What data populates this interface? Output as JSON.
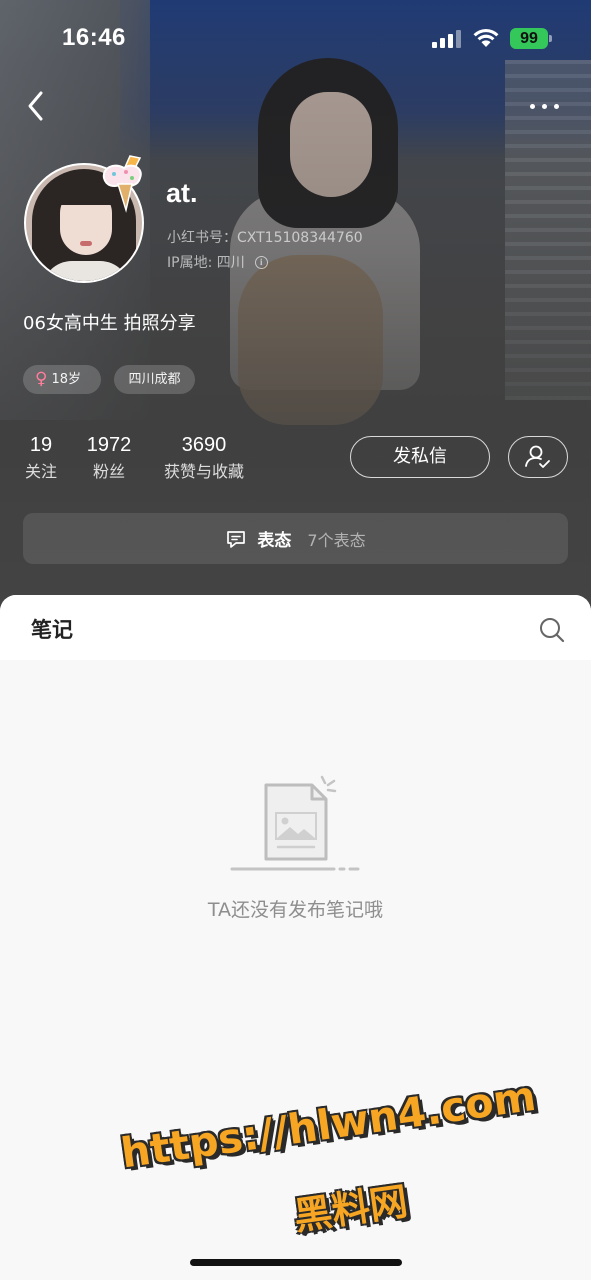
{
  "status_bar": {
    "time": "16:46",
    "battery": "99"
  },
  "profile": {
    "username": "at.",
    "id_label": "小红书号：",
    "id_value": "CXT15108344760",
    "ip_label": "IP属地: ",
    "ip_value": "四川",
    "bio": "06女高中生 拍照分享",
    "tags": {
      "age": "18岁",
      "location": "四川成都"
    }
  },
  "stats": [
    {
      "value": "19",
      "label": "关注"
    },
    {
      "value": "1972",
      "label": "粉丝"
    },
    {
      "value": "3690",
      "label": "获赞与收藏"
    }
  ],
  "actions": {
    "message": "发私信"
  },
  "moments": {
    "title": "表态",
    "count": "7个表态"
  },
  "notes": {
    "tab_title": "笔记",
    "empty_text": "TA还没有发布笔记哦"
  },
  "watermark": {
    "line1": "https://hlwn4.com",
    "line2": "黑料网"
  },
  "icons": {
    "back": "back-chevron-icon",
    "more": "more-dots-icon",
    "search": "search-icon",
    "follow": "user-check-icon",
    "moments": "chat-bubble-icon",
    "gender": "female-icon",
    "info": "info-icon"
  },
  "colors": {
    "battery": "#34c759",
    "female": "#ff7d9c",
    "watermark": "#f6a623"
  }
}
